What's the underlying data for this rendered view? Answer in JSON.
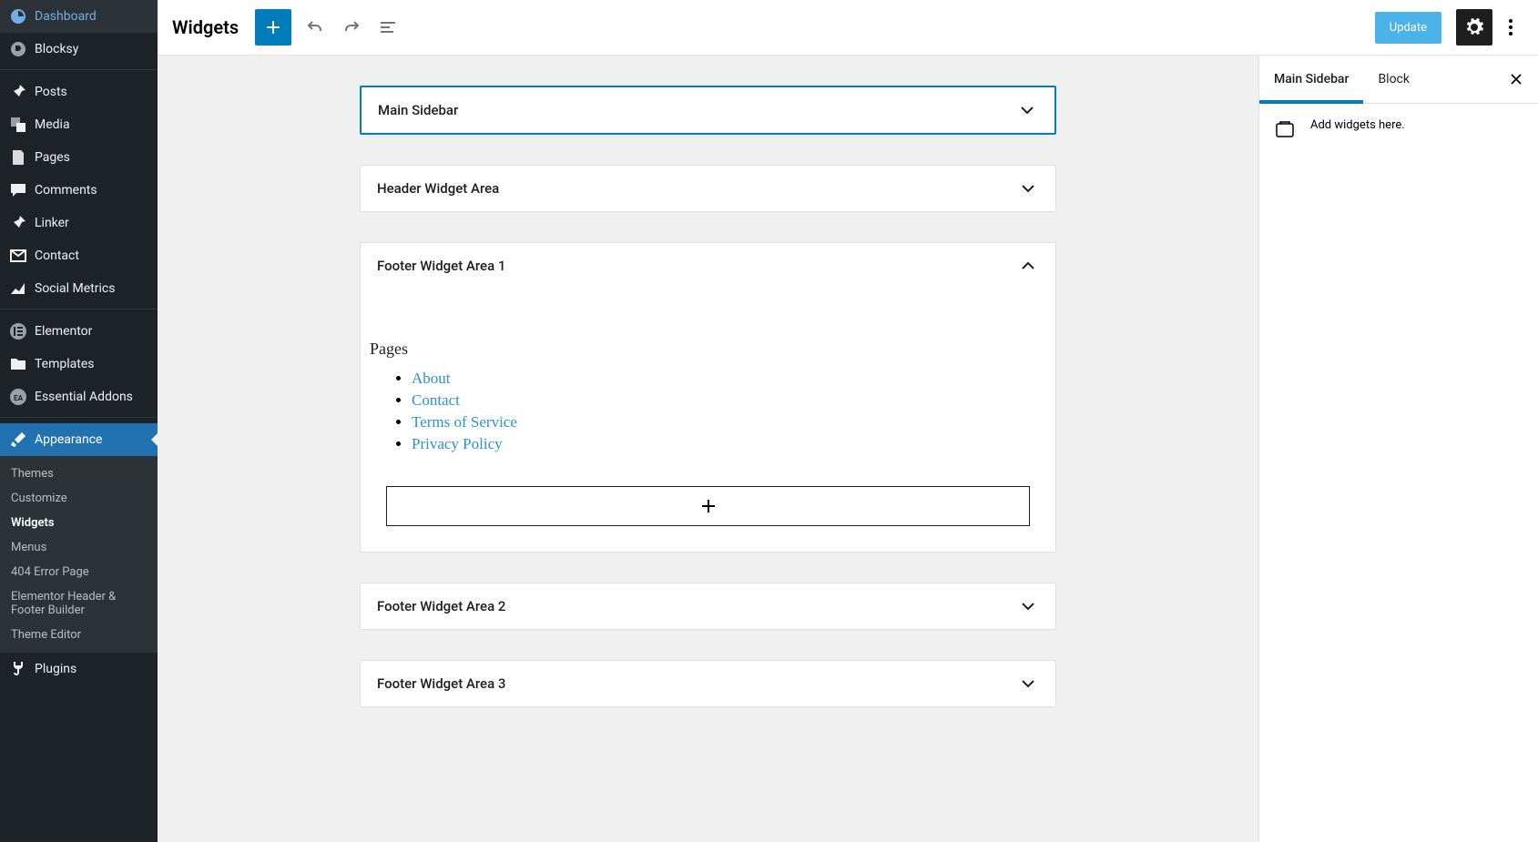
{
  "sidebar": {
    "items": [
      {
        "label": "Dashboard",
        "icon": "dashboard"
      },
      {
        "label": "Blocksy",
        "icon": "blocksy"
      }
    ],
    "items2": [
      {
        "label": "Posts",
        "icon": "pin"
      },
      {
        "label": "Media",
        "icon": "media"
      },
      {
        "label": "Pages",
        "icon": "page"
      },
      {
        "label": "Comments",
        "icon": "comment"
      },
      {
        "label": "Linker",
        "icon": "pin"
      },
      {
        "label": "Contact",
        "icon": "mail"
      },
      {
        "label": "Social Metrics",
        "icon": "chart"
      }
    ],
    "items3": [
      {
        "label": "Elementor",
        "icon": "elementor"
      },
      {
        "label": "Templates",
        "icon": "folder"
      },
      {
        "label": "Essential Addons",
        "icon": "ea"
      }
    ],
    "active": {
      "label": "Appearance",
      "icon": "brush"
    },
    "submenu": [
      {
        "label": "Themes"
      },
      {
        "label": "Customize"
      },
      {
        "label": "Widgets",
        "current": true
      },
      {
        "label": "Menus"
      },
      {
        "label": "404 Error Page"
      },
      {
        "label": "Elementor Header & Footer Builder"
      },
      {
        "label": "Theme Editor"
      }
    ],
    "items4": [
      {
        "label": "Plugins",
        "icon": "plug"
      }
    ]
  },
  "toolbar": {
    "title": "Widgets",
    "update_label": "Update"
  },
  "areas": [
    {
      "title": "Main Sidebar",
      "selected": true,
      "open": false
    },
    {
      "title": "Header Widget Area",
      "selected": false,
      "open": false
    },
    {
      "title": "Footer Widget Area 1",
      "selected": false,
      "open": true,
      "pages_heading": "Pages",
      "pages": [
        "About",
        "Contact",
        "Terms of Service",
        "Privacy Policy"
      ]
    },
    {
      "title": "Footer Widget Area 2",
      "selected": false,
      "open": false
    },
    {
      "title": "Footer Widget Area 3",
      "selected": false,
      "open": false
    }
  ],
  "panel": {
    "tab1": "Main Sidebar",
    "tab2": "Block",
    "message": "Add widgets here."
  }
}
